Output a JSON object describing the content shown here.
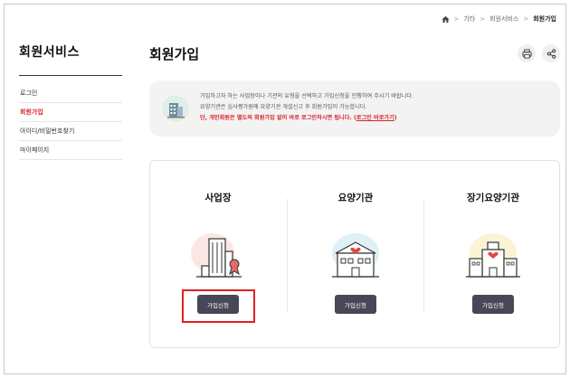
{
  "breadcrumb": {
    "home_icon": "home-icon",
    "items": [
      "기타",
      "회원서비스",
      "회원가입"
    ],
    "separator": ">"
  },
  "sidebar": {
    "title": "회원서비스",
    "items": [
      {
        "label": "로그인",
        "active": false
      },
      {
        "label": "회원가입",
        "active": true
      },
      {
        "label": "아이디/비밀번호찾기",
        "active": false
      },
      {
        "label": "마이페이지",
        "active": false
      }
    ]
  },
  "main": {
    "title": "회원가입",
    "tools": {
      "print_icon": "print-icon",
      "share_icon": "share-icon"
    }
  },
  "notice": {
    "line1": "가입하고자 하는 사업장이나 기관의 유형을 선택하고 가입신청을 진행하여 주시기 바랍니다.",
    "line2": "요양기관은 심사평가원에 요양기관 개설신고 후 회원가입이 가능합니다.",
    "line3_prefix": "단, 개인회원은 별도의 회원가입 없이 바로 로그인하시면 됩니다. (",
    "line3_link": "로그인 바로가기",
    "line3_suffix": ")"
  },
  "cards": [
    {
      "title": "사업장",
      "button": "가입신청",
      "icon": "office-building-icon",
      "highlighted": true
    },
    {
      "title": "요양기관",
      "button": "가입신청",
      "icon": "hospital-icon",
      "highlighted": false
    },
    {
      "title": "장기요양기관",
      "button": "가입신청",
      "icon": "care-facility-icon",
      "highlighted": false
    }
  ],
  "colors": {
    "accent_red": "#d6262e",
    "button_dark": "#474757",
    "highlight_box": "#e02020"
  }
}
